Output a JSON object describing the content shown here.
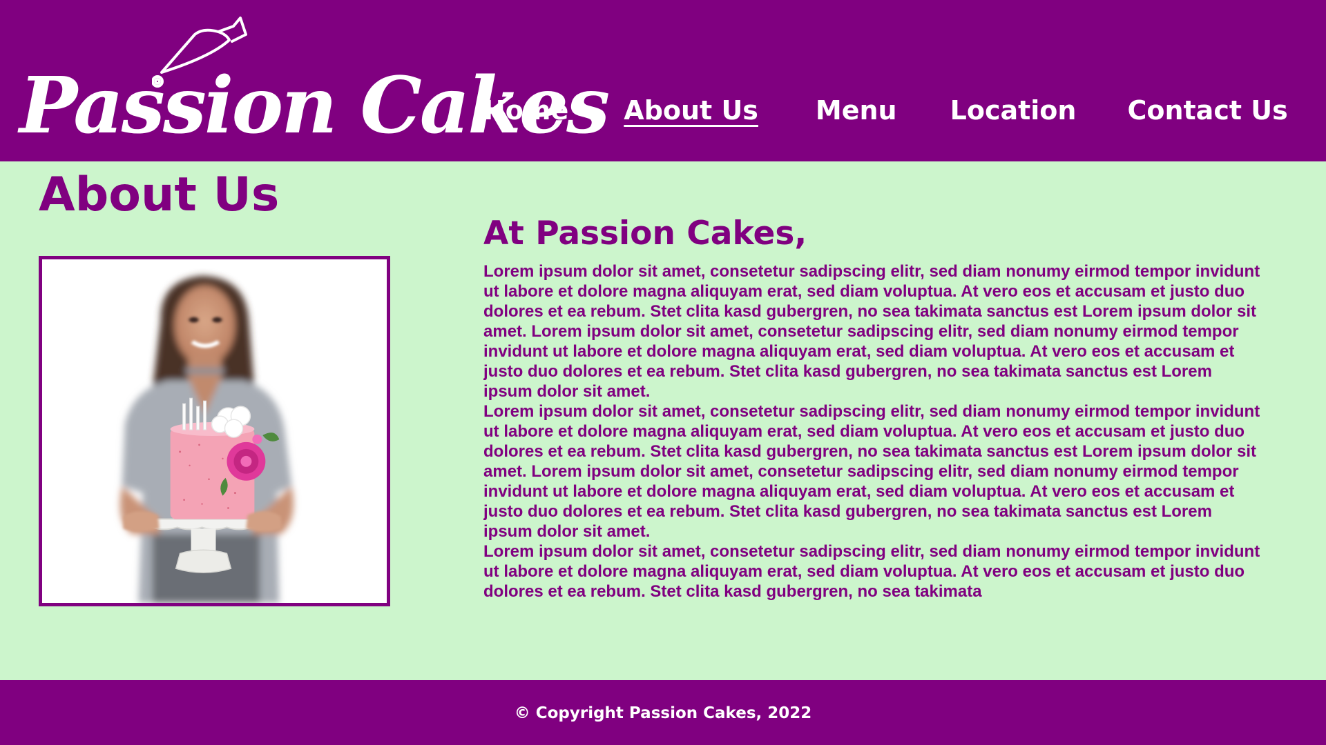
{
  "brand": {
    "name": "Passion Cakes",
    "logo_icon": "piping-bag-icon"
  },
  "nav": {
    "items": [
      {
        "label": "Home",
        "active": false
      },
      {
        "label": "About Us",
        "active": true
      },
      {
        "label": "Menu",
        "active": false
      },
      {
        "label": "Location",
        "active": false
      },
      {
        "label": "Contact Us",
        "active": false
      }
    ]
  },
  "main": {
    "page_title": "About Us",
    "intro_heading": "At Passion Cakes,",
    "paragraphs": [
      "Lorem ipsum dolor sit amet, consetetur sadipscing elitr, sed diam nonumy eirmod tempor invidunt ut labore et dolore magna aliquyam erat, sed diam voluptua. At vero eos et accusam et justo duo dolores et ea rebum. Stet clita kasd gubergren, no sea takimata sanctus est Lorem ipsum dolor sit amet. Lorem ipsum dolor sit amet, consetetur sadipscing elitr, sed diam nonumy eirmod tempor invidunt ut labore et dolore magna aliquyam erat, sed diam voluptua. At vero eos et accusam et justo duo dolores et ea rebum. Stet clita kasd gubergren, no sea takimata sanctus est Lorem ipsum dolor sit amet.",
      "Lorem ipsum dolor sit amet, consetetur sadipscing elitr, sed diam nonumy eirmod tempor invidunt ut labore et dolore magna aliquyam erat, sed diam voluptua. At vero eos et accusam et justo duo dolores et ea rebum. Stet clita kasd gubergren, no sea takimata sanctus est Lorem ipsum dolor sit amet. Lorem ipsum dolor sit amet, consetetur sadipscing elitr, sed diam nonumy eirmod tempor invidunt ut labore et dolore magna aliquyam erat, sed diam voluptua. At vero eos et accusam et justo duo dolores et ea rebum. Stet clita kasd gubergren, no sea takimata sanctus est Lorem ipsum dolor sit amet.",
      "Lorem ipsum dolor sit amet, consetetur sadipscing elitr, sed diam nonumy eirmod tempor invidunt ut labore et dolore magna aliquyam erat, sed diam voluptua. At vero eos et accusam et justo duo dolores et ea rebum. Stet clita kasd gubergren, no sea takimata"
    ],
    "photo_icon": "baker-with-cake-photo"
  },
  "footer": {
    "copyright": "© Copyright Passion Cakes, 2022"
  },
  "colors": {
    "brand_purple": "#800080",
    "page_background": "#ccf5cc",
    "nav_text": "#ffffff",
    "cake_pink": "#f4a3b5",
    "flower_magenta": "#e0399a"
  }
}
